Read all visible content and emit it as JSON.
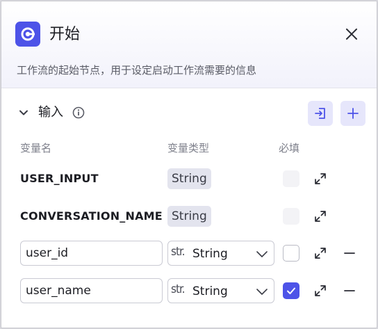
{
  "node": {
    "title": "开始",
    "description": "工作流的起始节点，用于设定启动工作流需要的信息"
  },
  "input_section": {
    "title": "输入",
    "columns": [
      "变量名",
      "变量类型",
      "必填"
    ]
  },
  "fixed_vars": [
    {
      "name": "USER_INPUT",
      "type": "String"
    },
    {
      "name": "CONVERSATION_NAME",
      "type": "String"
    }
  ],
  "editable_vars": [
    {
      "name": "user_id",
      "type_prefix": "str.",
      "type": "String",
      "required": false
    },
    {
      "name": "user_name",
      "type_prefix": "str.",
      "type": "String",
      "required": true
    }
  ],
  "colors": {
    "accent": "#4d53e8",
    "accent_soft": "#e6e6fb"
  },
  "icons": [
    "start-node-icon",
    "close-icon",
    "chevron-down-icon",
    "info-icon",
    "import-icon",
    "plus-icon",
    "expand-icon",
    "minus-icon",
    "check-icon"
  ]
}
